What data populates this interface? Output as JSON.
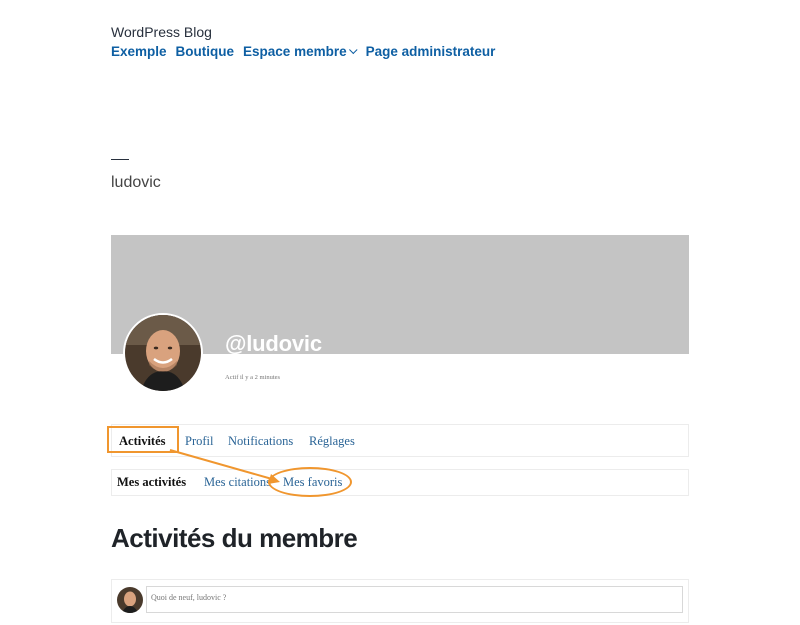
{
  "header": {
    "site_title": "WordPress Blog",
    "nav": [
      {
        "label": "Exemple"
      },
      {
        "label": "Boutique"
      },
      {
        "label": "Espace membre",
        "has_dropdown": true
      },
      {
        "label": "Page administrateur"
      }
    ]
  },
  "page": {
    "title": "ludovic"
  },
  "profile": {
    "handle": "@ludovic",
    "last_active": "Actif il y a 2 minutes"
  },
  "tabs": [
    {
      "label": "Activités",
      "active": true
    },
    {
      "label": "Profil"
    },
    {
      "label": "Notifications"
    },
    {
      "label": "Réglages"
    }
  ],
  "subtabs": [
    {
      "label": "Mes activités",
      "active": true
    },
    {
      "label": "Mes citations"
    },
    {
      "label": "Mes favoris"
    }
  ],
  "section": {
    "title": "Activités du membre"
  },
  "post_form": {
    "placeholder": "Quoi de neuf, ludovic ?"
  },
  "colors": {
    "link": "#0e5fa3",
    "highlight": "#f0962e",
    "cover": "#c4c4c4"
  }
}
